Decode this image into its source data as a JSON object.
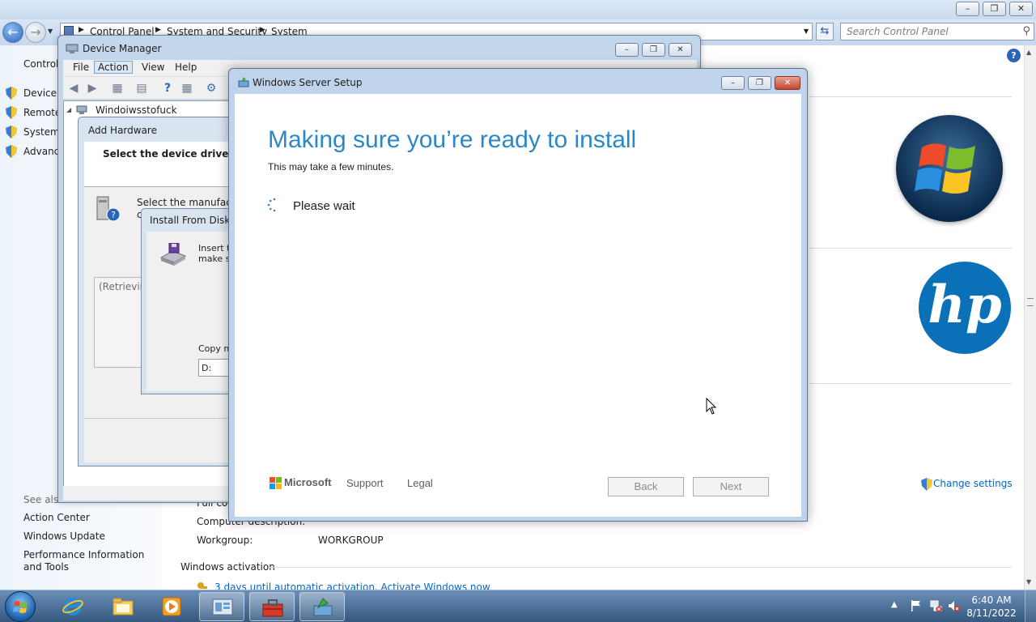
{
  "control_panel": {
    "breadcrumb": [
      "Control Panel",
      "System and Security",
      "System"
    ],
    "search_placeholder": "Search Control Panel",
    "left_title": "Control",
    "left_links": [
      "Device M",
      "Remote",
      "System",
      "Advanc"
    ],
    "see_also": "See also",
    "bottom_links": [
      "Action Center",
      "Windows Update",
      "Performance Information and Tools"
    ],
    "full_computer_label": "Full co",
    "computer_description_label": "Computer description:",
    "workgroup_label": "Workgroup:",
    "workgroup_value": "WORKGROUP",
    "activation_heading": "Windows activation",
    "activation_link": "3 days until automatic activation. Activate Windows now",
    "change_settings": "Change settings",
    "hp_text": "hp"
  },
  "device_manager": {
    "title": "Device Manager",
    "menu": [
      "File",
      "Action",
      "View",
      "Help"
    ],
    "active_menu": "Action",
    "tree_root": "Windoiwsstofuck"
  },
  "add_hardware": {
    "title": "Add Hardware",
    "heading": "Select the device driver yo",
    "text_line1": "Select the manufactu",
    "text_line2": "c",
    "list_text": "(Retrievin"
  },
  "install_from_disk": {
    "title": "Install From Disk",
    "line1": "Insert th",
    "line2": "make su",
    "copy_label": "Copy ma",
    "path_value": "D:"
  },
  "setup": {
    "title": "Windows Server Setup",
    "heading": "Making sure you’re ready to install",
    "subtitle": "This may take a few minutes.",
    "wait_text": "Please wait",
    "brand": "Microsoft",
    "support": "Support",
    "legal": "Legal",
    "back": "Back",
    "next": "Next"
  },
  "taskbar": {
    "time": "6:40 AM",
    "date": "8/11/2022",
    "apps": [
      "internet-explorer",
      "file-explorer",
      "media-player",
      "server-manager",
      "toolbox",
      "windows-setup"
    ]
  }
}
